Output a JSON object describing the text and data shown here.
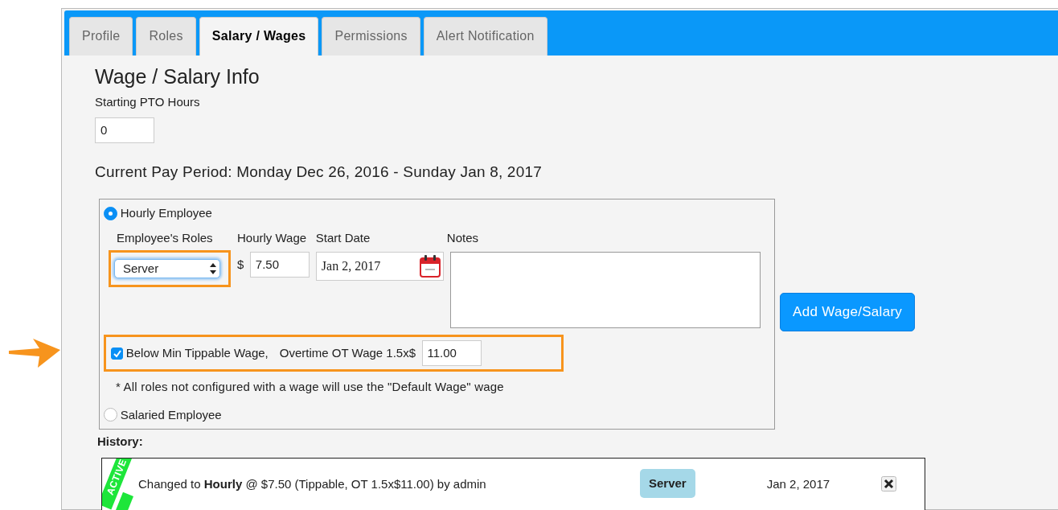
{
  "tabs": [
    {
      "label": "Profile",
      "selected": false
    },
    {
      "label": "Roles",
      "selected": false
    },
    {
      "label": "Salary / Wages",
      "selected": true
    },
    {
      "label": "Permissions",
      "selected": false
    },
    {
      "label": "Alert Notification",
      "selected": false
    }
  ],
  "section_title": "Wage / Salary Info",
  "pto": {
    "label": "Starting PTO Hours",
    "value": "0"
  },
  "pay_period": "Current Pay Period: Monday Dec 26, 2016 - Sunday Jan 8, 2017",
  "employee_types": [
    {
      "label": "Hourly Employee",
      "selected": true
    },
    {
      "label": "Salaried Employee",
      "selected": false
    }
  ],
  "form": {
    "role": {
      "label": "Employee's Roles",
      "value": "Server"
    },
    "wage": {
      "label": "Hourly Wage",
      "currency": "$",
      "value": "7.50"
    },
    "start_date": {
      "label": "Start Date",
      "value": "Jan 2, 2017"
    },
    "notes": {
      "label": "Notes"
    },
    "tippable": {
      "label": "Below Min Tippable Wage,",
      "checked": true
    },
    "overtime": {
      "label": "Overtime OT Wage 1.5x$",
      "value": "11.00"
    },
    "footnote": "* All roles not configured with a wage will use the \"Default Wage\" wage"
  },
  "add_button": "Add Wage/Salary",
  "history": {
    "label": "History:",
    "rows": [
      {
        "status": "ACTIVE",
        "description": "Changed to **Hourly** @ $7.50 (Tippable, OT 1.5x$11.00) by admin",
        "role": "Server",
        "date": "Jan 2, 2017"
      }
    ]
  }
}
